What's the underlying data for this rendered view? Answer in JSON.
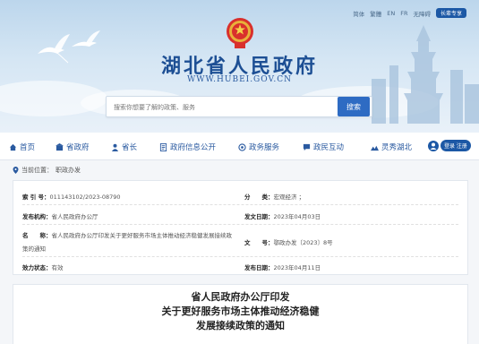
{
  "top_links": {
    "items": [
      "简体",
      "繁體",
      "EN",
      "FR",
      "无障碍"
    ],
    "elder_mode": "长辈专享"
  },
  "site": {
    "title": "湖北省人民政府",
    "url": "WWW.HUBEI.GOV.CN"
  },
  "search": {
    "placeholder": "搜索你想要了解的政策、服务",
    "button_label": "搜索"
  },
  "nav": {
    "items": [
      {
        "label": "首页",
        "icon": "home-icon"
      },
      {
        "label": "省政府",
        "icon": "building-icon"
      },
      {
        "label": "省长",
        "icon": "person-icon"
      },
      {
        "label": "政府信息公开",
        "icon": "document-icon"
      },
      {
        "label": "政务服务",
        "icon": "service-icon"
      },
      {
        "label": "政民互动",
        "icon": "chat-icon"
      },
      {
        "label": "灵秀湖北",
        "icon": "landscape-icon"
      }
    ],
    "login_label": "登录 注册"
  },
  "breadcrumb": {
    "prefix": "当前位置：",
    "current": "职政办发"
  },
  "meta": {
    "index_label": "索 引 号：",
    "index_value": "011143102/2023-08790",
    "category_label": "分　　类：",
    "category_value": "宏观经济 ；",
    "issuer_label": "发布机构：",
    "issuer_value": "省人民政府办公厅",
    "date_label": "发文日期：",
    "date_value": "2023年04月03日",
    "name_label": "名　　称：",
    "name_value": "省人民政府办公厅印发关于更好服务市场主体推动经济稳健发展接续政策的通知",
    "docno_label": "文　　号：",
    "docno_value": "鄂政办发〔2023〕8号",
    "validity_label": "效力状态：",
    "validity_value": "有效",
    "publish_label": "发布日期：",
    "publish_value": "2023年04月11日"
  },
  "article": {
    "title_line1": "省人民政府办公厅印发",
    "title_line2": "关于更好服务市场主体推动经济稳健",
    "title_line3": "发展接续政策的通知"
  }
}
